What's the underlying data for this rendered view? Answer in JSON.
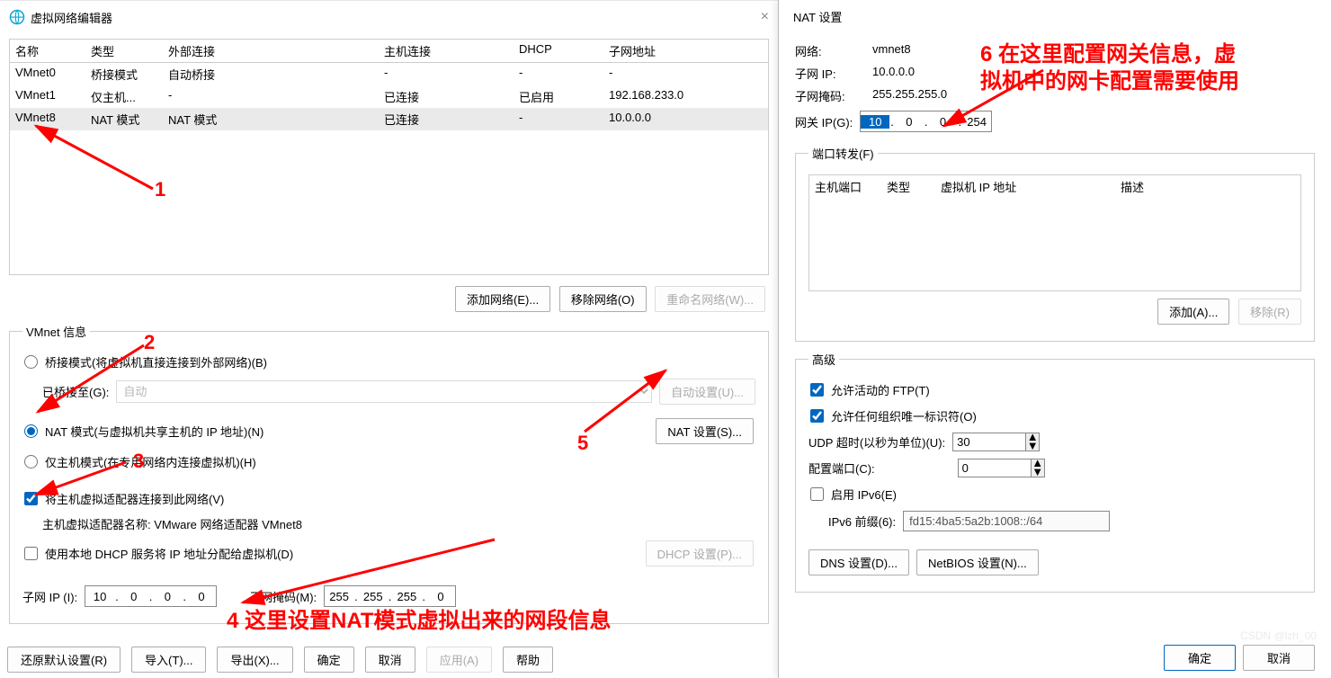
{
  "mainWin": {
    "title": "虚拟网络编辑器",
    "table": {
      "headers": {
        "name": "名称",
        "type": "类型",
        "ext": "外部连接",
        "host": "主机连接",
        "dhcp": "DHCP",
        "sub": "子网地址"
      },
      "rows": [
        {
          "name": "VMnet0",
          "type": "桥接模式",
          "ext": "自动桥接",
          "host": "",
          "dhcp": "",
          "sub": ""
        },
        {
          "name": "VMnet1",
          "type": "仅主机...",
          "ext": "",
          "host": "已连接",
          "dhcp": "已启用",
          "sub": "192.168.233.0"
        },
        {
          "name": "VMnet8",
          "type": "NAT 模式",
          "ext": "NAT 模式",
          "host": "已连接",
          "dhcp": "-",
          "sub": "10.0.0.0"
        }
      ]
    },
    "btnAdd": "添加网络(E)...",
    "btnRemove": "移除网络(O)",
    "btnRename": "重命名网络(W)...",
    "group": "VMnet 信息",
    "rBridge": "桥接模式(将虚拟机直接连接到外部网络)(B)",
    "bridgeToLbl": "已桥接至(G):",
    "bridgeAuto": "自动",
    "btnAuto": "自动设置(U)...",
    "rNat": "NAT 模式(与虚拟机共享主机的 IP 地址)(N)",
    "btnNat": "NAT 设置(S)...",
    "rHost": "仅主机模式(在专用网络内连接虚拟机)(H)",
    "chkHost": "将主机虚拟适配器连接到此网络(V)",
    "hostAdapter": "主机虚拟适配器名称: VMware 网络适配器 VMnet8",
    "chkDhcp": "使用本地 DHCP 服务将 IP 地址分配给虚拟机(D)",
    "btnDhcp": "DHCP 设置(P)...",
    "subIpLbl": "子网 IP (I):",
    "subIp": [
      "10",
      "0",
      "0",
      "0"
    ],
    "maskLbl": "子网掩码(M):",
    "mask": [
      "255",
      "255",
      "255",
      "0"
    ],
    "btnRestore": "还原默认设置(R)",
    "btnImport": "导入(T)...",
    "btnExport": "导出(X)...",
    "btnOk": "确定",
    "btnCancel": "取消",
    "btnApply": "应用(A)",
    "btnHelp": "帮助"
  },
  "natWin": {
    "title": "NAT 设置",
    "netLbl": "网络:",
    "netVal": "vmnet8",
    "subIpLbl": "子网 IP:",
    "subIpVal": "10.0.0.0",
    "maskLbl": "子网掩码:",
    "maskVal": "255.255.255.0",
    "gwLbl": "网关 IP(G):",
    "gw": [
      "10",
      "0",
      "0",
      "254"
    ],
    "portGroup": "端口转发(F)",
    "portHead": {
      "p1": "主机端口",
      "p2": "类型",
      "p3": "虚拟机 IP 地址",
      "p4": "描述"
    },
    "btnPortAdd": "添加(A)...",
    "btnPortRemove": "移除(R)",
    "advGroup": "高级",
    "chkFtp": "允许活动的 FTP(T)",
    "chkOrg": "允许任何组织唯一标识符(O)",
    "udpLbl": "UDP 超时(以秒为单位)(U):",
    "udpVal": "30",
    "cfgPortLbl": "配置端口(C):",
    "cfgPortVal": "0",
    "chkIpv6": "启用 IPv6(E)",
    "ipv6Lbl": "IPv6 前缀(6):",
    "ipv6Val": "fd15:4ba5:5a2b:1008::/64",
    "btnDns": "DNS 设置(D)...",
    "btnNetbios": "NetBIOS 设置(N)...",
    "btnOk": "确定",
    "btnCancel": "取消"
  },
  "annot": {
    "a1": "1",
    "a2": "2",
    "a3": "3",
    "a5": "5",
    "a4": "4  这里设置NAT模式虚拟出来的网段信息",
    "a6a": "6 在这里配置网关信息，虚",
    "a6b": "拟机中的网卡配置需要使用"
  },
  "watermark": "CSDN @lzh_00"
}
